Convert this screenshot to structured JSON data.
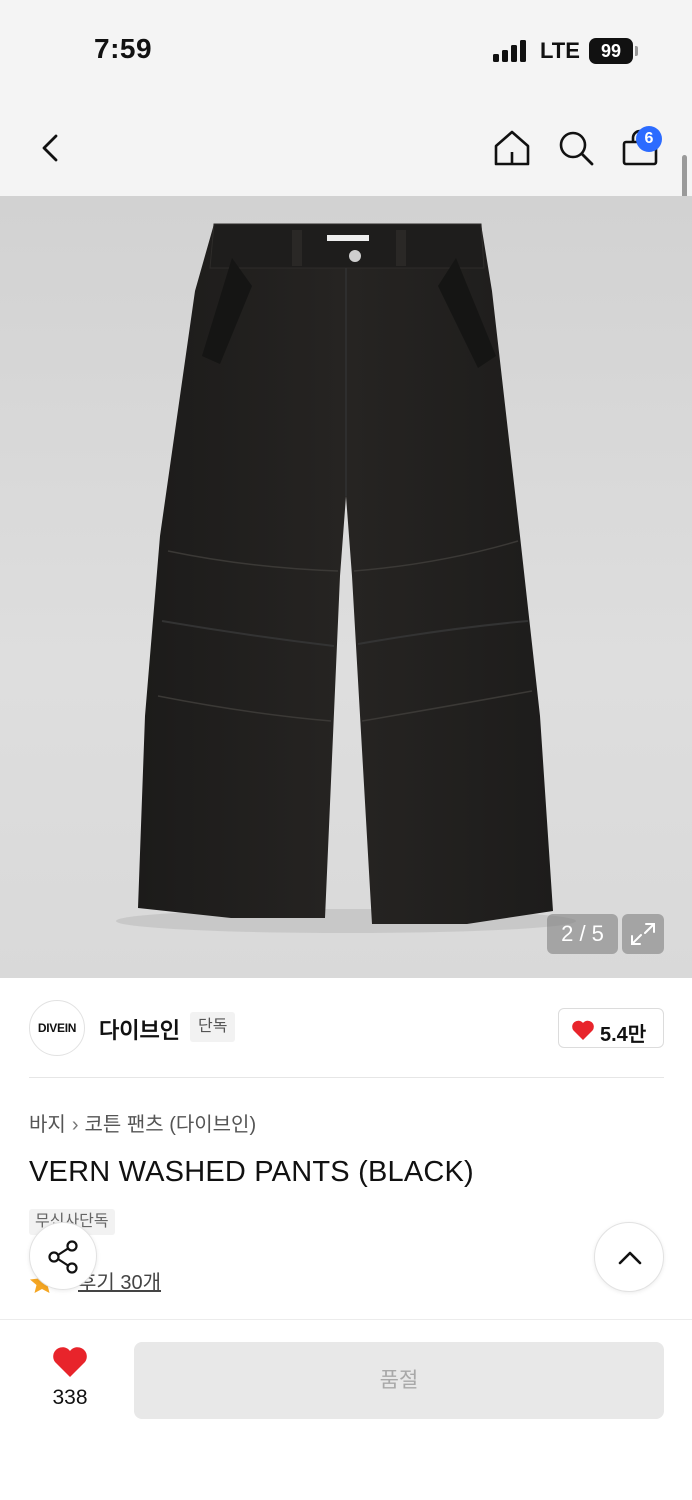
{
  "status_bar": {
    "time": "7:59",
    "network": "LTE",
    "battery": "99"
  },
  "nav": {
    "cart_count": "6",
    "icons": [
      "chevron-left-icon",
      "home-icon",
      "search-icon",
      "shopping-bag-icon"
    ]
  },
  "gallery": {
    "pager": "2 / 5",
    "image_alt": "black wide-leg pants"
  },
  "brand": {
    "logo_text": "DIVEIN",
    "name": "다이브인",
    "tag": "단독",
    "likes": "5.4만"
  },
  "product": {
    "breadcrumb": [
      "바지",
      "코튼 팬츠 (다이브인)"
    ],
    "title": "VERN WASHED PANTS (BLACK)",
    "exclusive_tag": "무신사단독",
    "review_link": "후기 30개"
  },
  "bottom": {
    "like_count": "338",
    "soldout_label": "품절"
  },
  "colors": {
    "accent_blue": "#2c6bff",
    "heart_red": "#e8242b",
    "star_orange": "#f5a623"
  }
}
